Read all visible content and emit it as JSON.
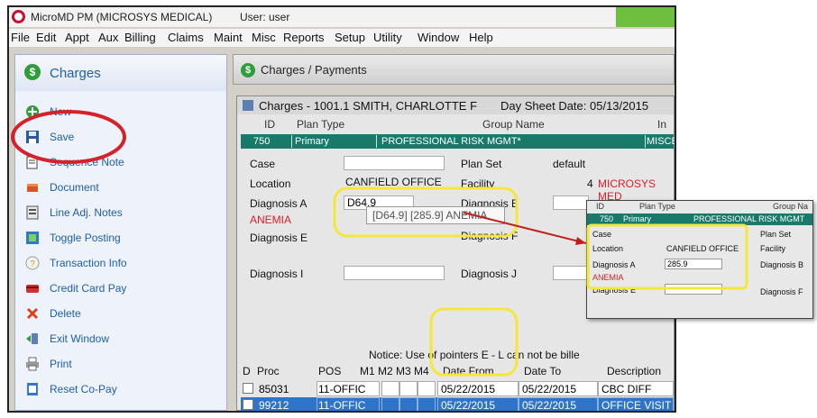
{
  "window": {
    "title": "MicroMD PM (MICROSYS MEDICAL)",
    "user_label": "User: user"
  },
  "menu": [
    "File",
    "Edit",
    "Appt",
    "Aux",
    "Billing",
    "Claims",
    "Maint",
    "Misc",
    "Reports",
    "Setup",
    "Utility",
    "Window",
    "Help"
  ],
  "sidebar": {
    "title": "Charges",
    "items": [
      {
        "label": "New",
        "icon": "plus-icon"
      },
      {
        "label": "Save",
        "icon": "save-icon"
      },
      {
        "label": "Sequence Note",
        "icon": "note-icon"
      },
      {
        "label": "Document",
        "icon": "document-icon"
      },
      {
        "label": "Line Adj. Notes",
        "icon": "notes-icon"
      },
      {
        "label": "Toggle Posting",
        "icon": "toggle-icon"
      },
      {
        "label": "Transaction Info",
        "icon": "info-icon"
      },
      {
        "label": "Credit Card Pay",
        "icon": "credit-card-icon"
      },
      {
        "label": "Delete",
        "icon": "delete-icon"
      },
      {
        "label": "Exit Window",
        "icon": "exit-icon"
      },
      {
        "label": "Print",
        "icon": "print-icon"
      },
      {
        "label": "Reset Co-Pay",
        "icon": "reset-icon"
      }
    ]
  },
  "panel": {
    "title": "Charges / Payments"
  },
  "charges": {
    "title": "Charges - 1001.1  SMITH, CHARLOTTE F",
    "day_sheet": "Day Sheet Date: 05/13/2015",
    "headers": {
      "id": "ID",
      "plan_type": "Plan Type",
      "group_name": "Group Name",
      "ins": "In"
    },
    "plan": {
      "id": "750",
      "type": "Primary",
      "group": "PROFESSIONAL RISK MGMT*",
      "ins": "MISCEL"
    },
    "fields": {
      "case_label": "Case",
      "plan_set_label": "Plan Set",
      "plan_set_value": "default",
      "location_label": "Location",
      "location_value": "CANFIELD OFFICE",
      "facility_label": "Facility",
      "facility_num": "4",
      "facility_value": "MICROSYS MED",
      "diag_a_label": "Diagnosis A",
      "diag_a_value": "D64.9",
      "diag_a_desc": "ANEMIA",
      "diag_b_label": "Diagnosis B",
      "diag_e_label": "Diagnosis E",
      "diag_f_label": "Diagnosis F",
      "diag_i_label": "Diagnosis I",
      "diag_j_label": "Diagnosis J"
    },
    "tooltip": "[D64.9] [285.9] ANEMIA",
    "notice": "Notice: Use of pointers E - L can not be bille",
    "grid_headers": [
      "D",
      "Proc",
      "POS",
      "M1",
      "M2",
      "M3",
      "M4",
      "Date From",
      "Date To",
      "Description"
    ],
    "rows": [
      {
        "proc": "85031",
        "pos": "11-OFFIC",
        "date_from": "05/22/2015",
        "date_to": "05/22/2015",
        "description": "CBC DIFF",
        "selected": false
      },
      {
        "proc": "99212",
        "pos": "11-OFFIC",
        "date_from": "05/22/2015",
        "date_to": "05/22/2015",
        "description": "OFFICE VISIT",
        "selected": true
      }
    ]
  },
  "inset": {
    "headers": {
      "id": "ID",
      "plan_type": "Plan Type",
      "group_name": "Group Na"
    },
    "plan": {
      "id": "750",
      "type": "Primary",
      "group": "PROFESSIONAL RISK MGMT"
    },
    "case_label": "Case",
    "plan_set_label": "Plan Set",
    "location_label": "Location",
    "location_value": "CANFIELD OFFICE",
    "facility_label": "Facility",
    "diag_a_label": "Diagnosis A",
    "diag_a_value": "285.9",
    "diag_a_desc": "ANEMIA",
    "diag_b_label": "Diagnosis B",
    "diag_e_label": "Diagnosis E",
    "diag_f_label": "Diagnosis F"
  },
  "colors": {
    "teal_row": "#1a7a6a",
    "annotation_red": "#d6202a",
    "annotation_yellow": "#f5e63a",
    "selection_blue": "#2e74c9",
    "link_blue": "#1f5fa8"
  }
}
